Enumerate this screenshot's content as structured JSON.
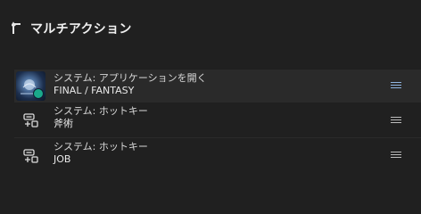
{
  "header": {
    "title": "マルチアクション",
    "back_icon": "corner-up-arrow-icon"
  },
  "actions": [
    {
      "type": "システム: アプリケーションを開く",
      "value": "FINAL / FANTASY",
      "icon": "app-thumbnail"
    },
    {
      "type": "システム: ホットキー",
      "value": "斧術",
      "icon": "hotkey-icon"
    },
    {
      "type": "システム: ホットキー",
      "value": "JOB",
      "icon": "hotkey-icon"
    }
  ],
  "colors": {
    "background": "#202020",
    "selected_row": "#2a2a2a",
    "badge": "#1aa98b"
  }
}
